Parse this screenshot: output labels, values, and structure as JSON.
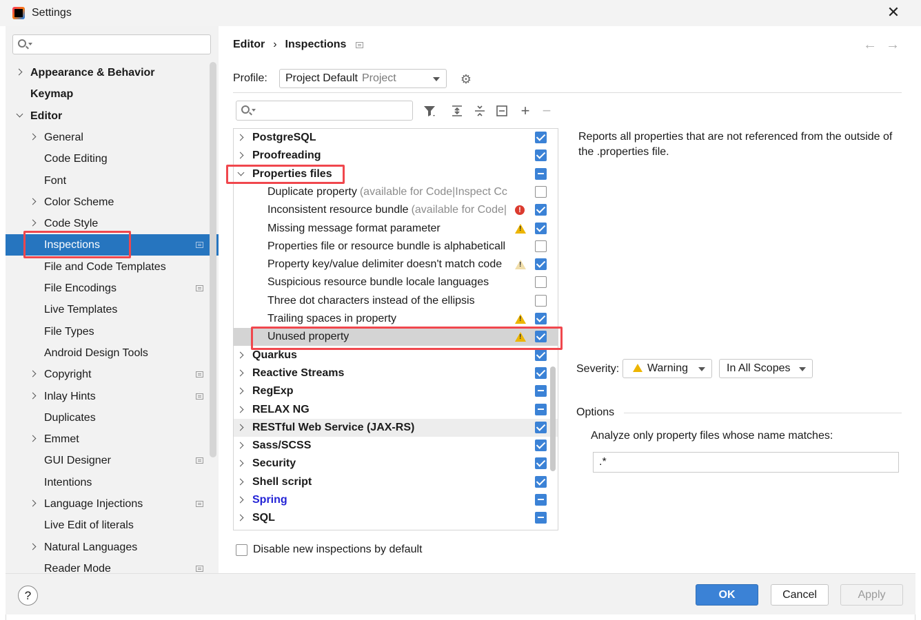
{
  "window": {
    "title": "Settings",
    "close_glyph": "✕"
  },
  "sidebar": {
    "search_placeholder": "",
    "items": [
      {
        "label": "Appearance & Behavior",
        "bold": true,
        "expandable": true,
        "expanded": false,
        "level": 0
      },
      {
        "label": "Keymap",
        "bold": true,
        "expandable": false,
        "level": 0
      },
      {
        "label": "Editor",
        "bold": true,
        "expandable": true,
        "expanded": true,
        "level": 0
      },
      {
        "label": "General",
        "expandable": true,
        "level": 1
      },
      {
        "label": "Code Editing",
        "level": 1
      },
      {
        "label": "Font",
        "level": 1
      },
      {
        "label": "Color Scheme",
        "expandable": true,
        "level": 1
      },
      {
        "label": "Code Style",
        "expandable": true,
        "level": 1
      },
      {
        "label": "Inspections",
        "level": 1,
        "selected": true,
        "project_scoped": true
      },
      {
        "label": "File and Code Templates",
        "level": 1
      },
      {
        "label": "File Encodings",
        "level": 1,
        "project_scoped": true
      },
      {
        "label": "Live Templates",
        "level": 1
      },
      {
        "label": "File Types",
        "level": 1
      },
      {
        "label": "Android Design Tools",
        "level": 1
      },
      {
        "label": "Copyright",
        "expandable": true,
        "level": 1,
        "project_scoped": true
      },
      {
        "label": "Inlay Hints",
        "expandable": true,
        "level": 1,
        "project_scoped": true
      },
      {
        "label": "Duplicates",
        "level": 1
      },
      {
        "label": "Emmet",
        "expandable": true,
        "level": 1
      },
      {
        "label": "GUI Designer",
        "level": 1,
        "project_scoped": true
      },
      {
        "label": "Intentions",
        "level": 1
      },
      {
        "label": "Language Injections",
        "expandable": true,
        "level": 1,
        "project_scoped": true
      },
      {
        "label": "Live Edit of literals",
        "level": 1
      },
      {
        "label": "Natural Languages",
        "expandable": true,
        "level": 1
      },
      {
        "label": "Reader Mode",
        "level": 1,
        "project_scoped": true
      }
    ]
  },
  "breadcrumb": {
    "parent": "Editor",
    "separator": "›",
    "current": "Inspections"
  },
  "nav": {
    "back": "←",
    "forward": "→"
  },
  "profile": {
    "label": "Profile:",
    "value": "Project Default",
    "scope": "Project"
  },
  "toolbar": {
    "filter_icon": "filter-icon",
    "expand_all_icon": "expand-all-icon",
    "collapse_all_icon": "collapse-all-icon",
    "reset_icon": "reset-icon",
    "add": "+",
    "remove": "−"
  },
  "inspections": [
    {
      "label": "PostgreSQL",
      "type": "group",
      "state": "checked"
    },
    {
      "label": "Proofreading",
      "type": "group",
      "state": "checked"
    },
    {
      "label": "Properties files",
      "type": "group",
      "state": "partial",
      "expanded": true
    },
    {
      "label": "Duplicate property",
      "hint": "(available for Code|Inspect Cc",
      "type": "child",
      "state": "empty"
    },
    {
      "label": "Inconsistent resource bundle",
      "hint": "(available for Code|",
      "type": "child",
      "state": "checked",
      "icon": "error"
    },
    {
      "label": "Missing message format parameter",
      "type": "child",
      "state": "checked",
      "icon": "warning"
    },
    {
      "label": "Properties file or resource bundle is alphabeticall",
      "type": "child",
      "state": "empty"
    },
    {
      "label": "Property key/value delimiter doesn't match code",
      "type": "child",
      "state": "checked",
      "icon": "weak-warning"
    },
    {
      "label": "Suspicious resource bundle locale languages",
      "type": "child",
      "state": "empty"
    },
    {
      "label": "Three dot characters instead of the ellipsis",
      "type": "child",
      "state": "empty"
    },
    {
      "label": "Trailing spaces in property",
      "type": "child",
      "state": "checked",
      "icon": "warning"
    },
    {
      "label": "Unused property",
      "type": "child",
      "state": "checked",
      "icon": "warning",
      "selected": true
    },
    {
      "label": "Quarkus",
      "type": "group",
      "state": "checked"
    },
    {
      "label": "Reactive Streams",
      "type": "group",
      "state": "checked"
    },
    {
      "label": "RegExp",
      "type": "group",
      "state": "partial"
    },
    {
      "label": "RELAX NG",
      "type": "group",
      "state": "partial"
    },
    {
      "label": "RESTful Web Service (JAX-RS)",
      "type": "group",
      "state": "checked",
      "hover": true
    },
    {
      "label": "Sass/SCSS",
      "type": "group",
      "state": "checked"
    },
    {
      "label": "Security",
      "type": "group",
      "state": "checked"
    },
    {
      "label": "Shell script",
      "type": "group",
      "state": "checked"
    },
    {
      "label": "Spring",
      "type": "group",
      "state": "partial",
      "link": true
    },
    {
      "label": "SQL",
      "type": "group",
      "state": "partial"
    }
  ],
  "description": "Reports all properties that are not referenced from the outside of the .properties file.",
  "severity": {
    "label": "Severity:",
    "value": "Warning",
    "scope": "In All Scopes"
  },
  "options": {
    "title": "Options",
    "field_label": "Analyze only property files whose name matches:",
    "field_value": ".*"
  },
  "disable_new": {
    "label": "Disable new inspections by default",
    "checked": false
  },
  "footer": {
    "help": "?",
    "ok": "OK",
    "cancel": "Cancel",
    "apply": "Apply"
  },
  "colors": {
    "accent": "#3b82d6",
    "selection": "#2675bf",
    "highlight_box": "#f0474d",
    "warning": "#edb500",
    "error": "#db3b2f"
  }
}
